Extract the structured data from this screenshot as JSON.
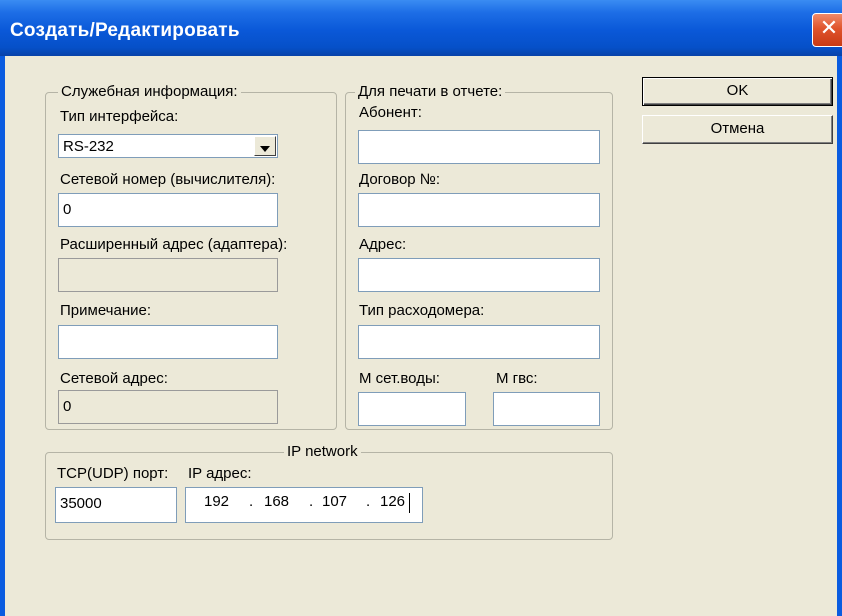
{
  "window": {
    "title": "Создать/Редактировать",
    "close_glyph": "✕"
  },
  "service_group": {
    "legend": "Служебная информация:",
    "interface_type": {
      "label": "Тип интерфейса:",
      "value": "RS-232"
    },
    "network_number": {
      "label": "Сетевой номер (вычислителя):",
      "value": "0"
    },
    "extended_address": {
      "label": "Расширенный адрес (адаптера):",
      "value": ""
    },
    "note": {
      "label": "Примечание:",
      "value": ""
    },
    "network_address": {
      "label": "Сетевой адрес:",
      "value": "0"
    }
  },
  "print_group": {
    "legend": "Для печати в отчете:",
    "subscriber": {
      "label": "Абонент:",
      "value": ""
    },
    "contract": {
      "label": "Договор №:",
      "value": ""
    },
    "address": {
      "label": "Адрес:",
      "value": ""
    },
    "flowmeter_type": {
      "label": "Тип расходомера:",
      "value": ""
    },
    "m_network_water": {
      "label": "М сет.воды:",
      "value": ""
    },
    "m_hot_water": {
      "label": "М гвс:",
      "value": ""
    }
  },
  "ip_group": {
    "legend": "IP network",
    "port_label": "TCP(UDP) порт:",
    "ip_label": "IP адрес:",
    "port_value": "35000",
    "ip_octets": [
      "192",
      "168",
      "107",
      "126"
    ],
    "ip_dot": "."
  },
  "buttons": {
    "ok": "OK",
    "cancel": "Отмена"
  }
}
